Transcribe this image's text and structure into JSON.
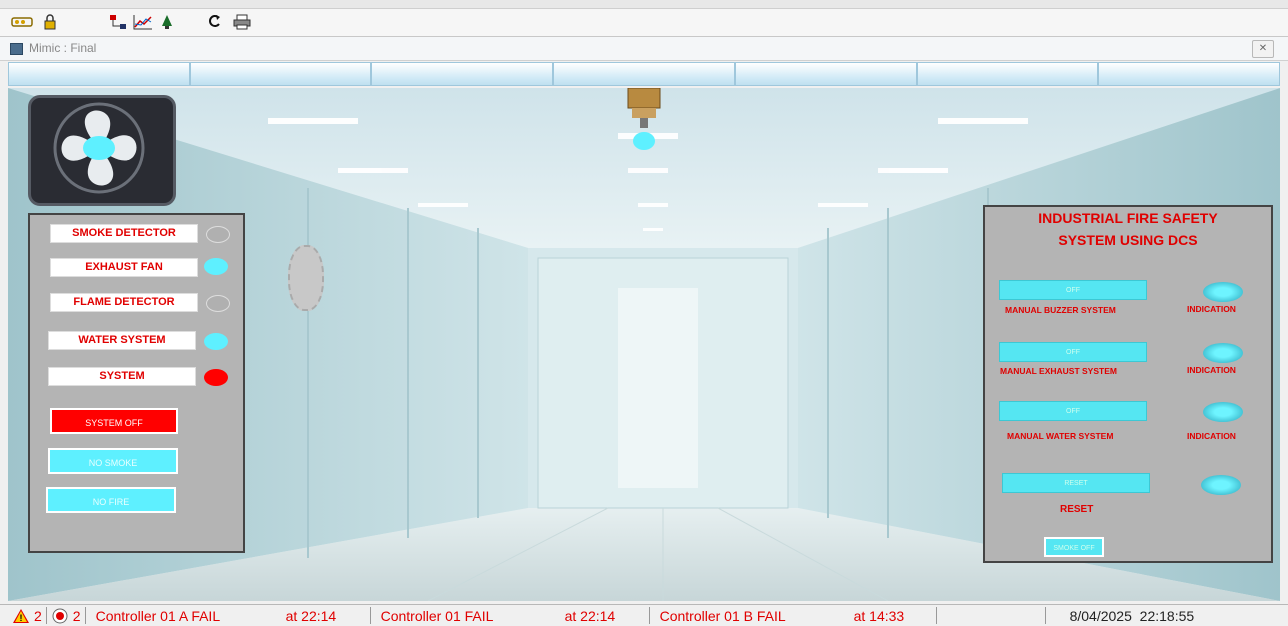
{
  "window": {
    "title": "Mimic : Final",
    "close_glyph": "✕"
  },
  "toolbar": {
    "icons": [
      "device-icon",
      "lock-icon",
      "network-icon",
      "trend-icon",
      "alarm-bell-icon",
      "refresh-icon",
      "print-icon"
    ]
  },
  "tabs": [
    "",
    "",
    "",
    "",
    "",
    "",
    ""
  ],
  "left_panel": {
    "items": [
      {
        "label": "SMOKE DETECTOR",
        "state_color": "#b0b0b0"
      },
      {
        "label": "EXHAUST FAN",
        "state_color": "#5ef0ff"
      },
      {
        "label": "FLAME DETECTOR",
        "state_color": "#b0b0b0"
      },
      {
        "label": "WATER SYSTEM",
        "state_color": "#5ef0ff"
      },
      {
        "label": "SYSTEM",
        "state_color": "#ff0000"
      }
    ],
    "buttons": {
      "system": "SYSTEM OFF",
      "smoke": "NO SMOKE",
      "fire": "NO FIRE"
    }
  },
  "right_panel": {
    "title_line1": "INDUSTRIAL FIRE SAFETY",
    "title_line2": "SYSTEM USING DCS",
    "controls": [
      {
        "button": "OFF",
        "label": "MANUAL BUZZER SYSTEM",
        "indicator": "INDICATION"
      },
      {
        "button": "OFF",
        "label": "MANUAL EXHAUST SYSTEM",
        "indicator": "INDICATION"
      },
      {
        "button": "OFF",
        "label": "MANUAL WATER SYSTEM",
        "indicator": "INDICATION"
      }
    ],
    "reset_button": "RESET",
    "reset_label": "RESET",
    "smoke_off_button": "SMOKE OFF"
  },
  "statusbar": {
    "alarm_count": "2",
    "fault_count": "2",
    "messages": [
      {
        "text": "Controller 01 A FAIL",
        "time": "at 22:14"
      },
      {
        "text": "Controller 01 FAIL",
        "time": "at 22:14"
      },
      {
        "text": "Controller 01 B FAIL",
        "time": "at 14:33"
      }
    ],
    "datetime": "8/04/2025  22:18:55"
  },
  "colors": {
    "accent_red": "#e00000",
    "cyan": "#5ef0ff",
    "panel_gray": "#b4b4b4"
  }
}
